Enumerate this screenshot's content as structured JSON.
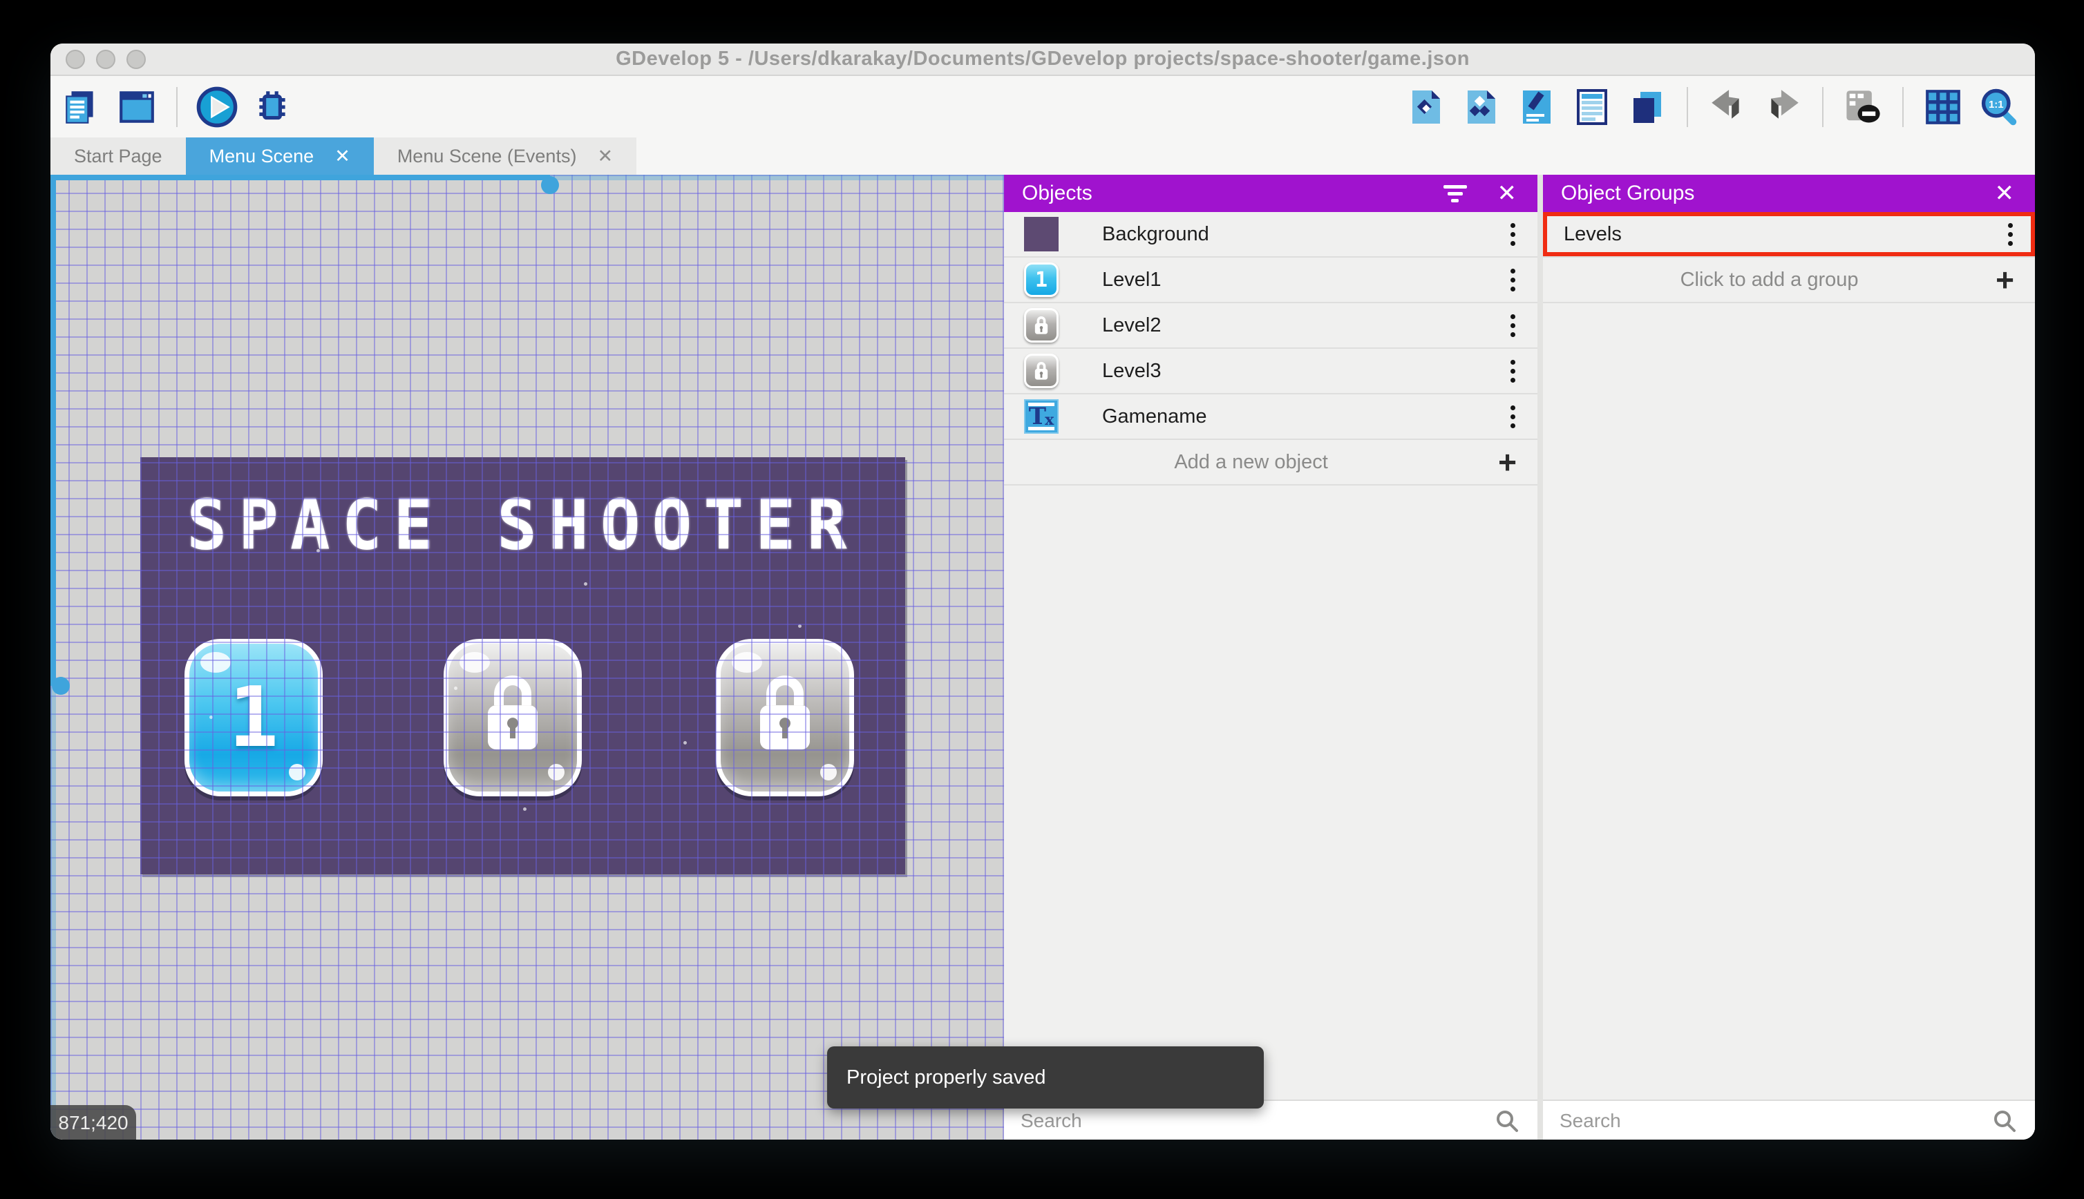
{
  "window": {
    "title": "GDevelop 5 - /Users/dkarakay/Documents/GDevelop projects/space-shooter/game.json",
    "controls": [
      "close",
      "minimize",
      "maximize"
    ]
  },
  "toolbar": {
    "left_icons": [
      "project-manager",
      "scene-window",
      "play",
      "debug"
    ],
    "right_icons": [
      "objects-panel",
      "object-groups-panel",
      "properties",
      "instances-list",
      "layers",
      "undo",
      "redo",
      "mask-toggle",
      "grid-toggle",
      "zoom-one-to-one"
    ],
    "zoom_label": "1:1"
  },
  "tabs": [
    {
      "label": "Start Page",
      "active": false,
      "closable": false
    },
    {
      "label": "Menu Scene",
      "active": true,
      "closable": true,
      "close_glyph": "✕"
    },
    {
      "label": "Menu Scene (Events)",
      "active": false,
      "closable": true,
      "close_glyph": "✕"
    }
  ],
  "canvas": {
    "coordinates": "871;420",
    "scene": {
      "title": "SPACE SHOOTER",
      "buttons": [
        {
          "label": "1",
          "state": "unlocked"
        },
        {
          "label": "",
          "state": "locked"
        },
        {
          "label": "",
          "state": "locked"
        }
      ]
    }
  },
  "objects_panel": {
    "title": "Objects",
    "header_icons": [
      "filter-icon",
      "close-icon"
    ],
    "close_glyph": "✕",
    "items": [
      {
        "name": "Background",
        "icon": "background-swatch"
      },
      {
        "name": "Level1",
        "icon": "level1-button"
      },
      {
        "name": "Level2",
        "icon": "locked-button"
      },
      {
        "name": "Level3",
        "icon": "locked-button"
      },
      {
        "name": "Gamename",
        "icon": "text-object"
      }
    ],
    "add_label": "Add a new object",
    "add_glyph": "+",
    "search_placeholder": "Search"
  },
  "object_groups_panel": {
    "title": "Object Groups",
    "close_glyph": "✕",
    "groups": [
      {
        "name": "Levels",
        "highlighted": true
      }
    ],
    "add_label": "Click to add a group",
    "add_glyph": "+",
    "search_placeholder": "Search"
  },
  "toast": {
    "message": "Project properly saved"
  },
  "colors": {
    "accent_blue": "#4AA5DC",
    "panel_header_purple": "#A013CE",
    "highlight_red": "#F02C12",
    "scene_purple": "#554570",
    "canvas_gray": "#D3D3D2",
    "toast_dark": "#3A3A3A"
  }
}
